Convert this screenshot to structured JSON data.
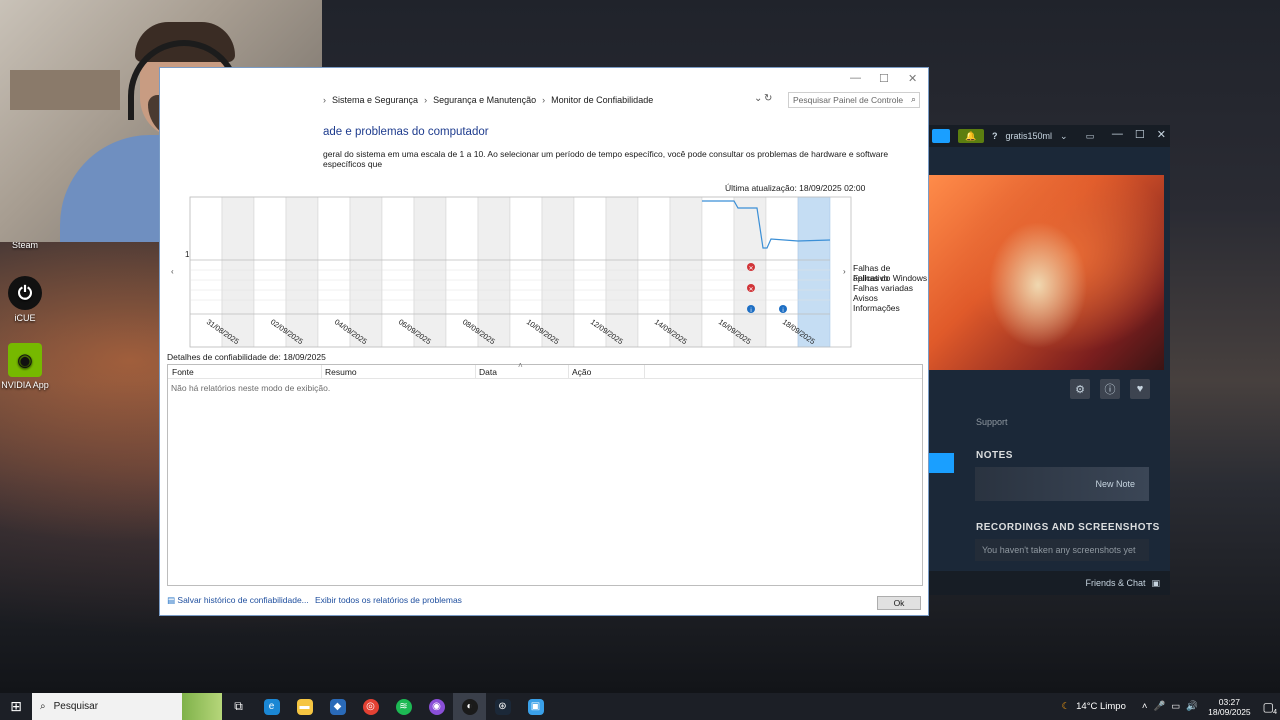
{
  "desktop": {
    "icons": [
      {
        "label": "Steam"
      },
      {
        "label": "iCUE"
      },
      {
        "label": "NVIDIA App"
      }
    ]
  },
  "reliability": {
    "breadcrumb": [
      "Sistema e Segurança",
      "Segurança e Manutenção",
      "Monitor de Confiabilidade"
    ],
    "search_placeholder": "Pesquisar Painel de Controle",
    "heading": "ade e problemas do computador",
    "description": "geral do sistema em uma escala de 1 a 10. Ao selecionar um período de tempo específico, você pode consultar os problemas de hardware e software específicos que",
    "last_update": "Última atualização: 18/09/2025 02:00",
    "index_label": "1",
    "legend": [
      "Falhas de aplicativo",
      "Falhas do Windows",
      "Falhas variadas",
      "Avisos",
      "Informações"
    ],
    "dates": [
      "31/08/2025",
      "02/09/2025",
      "04/09/2025",
      "06/09/2025",
      "08/09/2025",
      "10/09/2025",
      "12/09/2025",
      "14/09/2025",
      "16/09/2025",
      "18/09/2025"
    ],
    "details_label": "Detalhes de confiabilidade de: 18/09/2025",
    "columns": [
      "Fonte",
      "Resumo",
      "Data",
      "Ação"
    ],
    "empty_message": "Não há relatórios neste modo de exibição.",
    "link_save": "Salvar histórico de confiabilidade...",
    "link_all": "Exibir todos os relatórios de problemas",
    "ok_label": "Ok"
  },
  "steam": {
    "username": "gratis150ml",
    "support": "Support",
    "notes_heading": "NOTES",
    "new_note": "New Note",
    "recordings_heading": "RECORDINGS AND SCREENSHOTS",
    "recordings_empty": "You haven't taken any screenshots yet",
    "friends": "Friends & Chat"
  },
  "taskbar": {
    "search_label": "Pesquisar",
    "weather": "14°C  Limpo",
    "time": "03:27",
    "date": "18/09/2025",
    "notification_count": "4"
  }
}
